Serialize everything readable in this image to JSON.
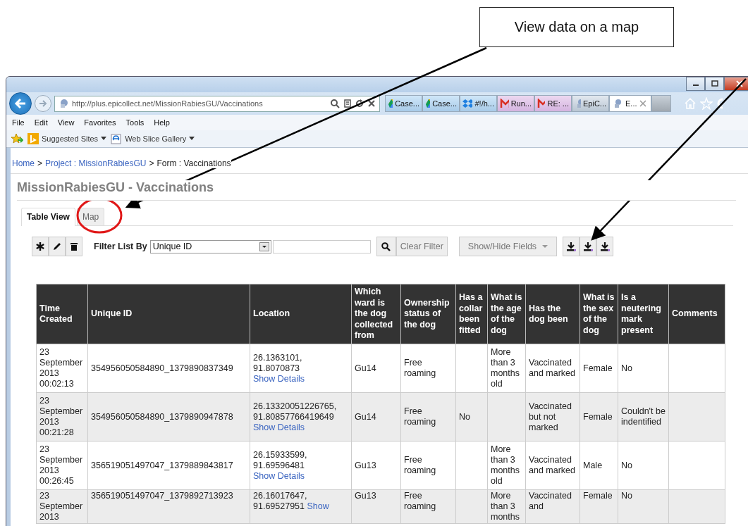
{
  "callout": {
    "text": "View data on a map"
  },
  "browser": {
    "address": "http://plus.epicollect.net/MissionRabiesGU/Vaccinations",
    "tabs": [
      {
        "label": "Case...",
        "kind": "drive",
        "selected": false
      },
      {
        "label": "Case...",
        "kind": "drive",
        "selected": false
      },
      {
        "label": "#!/h...",
        "kind": "box",
        "selected": false
      },
      {
        "label": "Run...",
        "kind": "mail",
        "selected": false
      },
      {
        "label": "RE: ...",
        "kind": "mail",
        "selected": false
      },
      {
        "label": "EpiC...",
        "kind": "page",
        "selected": false
      },
      {
        "label": "E...",
        "kind": "page",
        "selected": true
      }
    ],
    "menu": [
      "File",
      "Edit",
      "View",
      "Favorites",
      "Tools",
      "Help"
    ],
    "favorites": [
      "Suggested Sites",
      "Web Slice Gallery"
    ]
  },
  "page": {
    "breadcrumb": [
      {
        "text": "Home",
        "kind": "link"
      },
      {
        "text": ">",
        "kind": "separator"
      },
      {
        "text": "Project : MissionRabiesGU",
        "kind": "link"
      },
      {
        "text": ">",
        "kind": "separator"
      },
      {
        "text": "Form : Vaccinations",
        "kind": "current"
      }
    ],
    "title": "MissionRabiesGU - Vaccinations",
    "view_tabs": [
      {
        "label": "Table View",
        "selected": true
      },
      {
        "label": "Map",
        "selected": false
      }
    ],
    "filter_label": "Filter List By",
    "filter_select": "Unique ID",
    "clear_filter": "Clear Filter",
    "show_hide": "Show/Hide Fields",
    "table": {
      "columns": [
        "Time Created",
        "Unique ID",
        "Location",
        "Which ward is the dog collected from",
        "Ownership status of the dog",
        "Has a collar been fitted",
        "What is the age of the dog",
        "Has the dog been",
        "What is the sex of the dog",
        "Is a neutering mark present",
        "Comments"
      ],
      "rows": [
        {
          "cells": [
            "23 September 2013 00:02:13",
            "354956050584890_1379890837349",
            {
              "coords": "26.1363101, 91.8070873",
              "link": "Show Details"
            },
            "Gu14",
            "Free roaming",
            null,
            "More than 3 months old",
            "Vaccinated and marked",
            "Female",
            "No",
            null
          ]
        },
        {
          "cells": [
            "23 September 2013 00:21:28",
            "354956050584890_1379890947878",
            {
              "coords": "26.13320051226765, 91.80857766419649",
              "link": "Show Details"
            },
            "Gu14",
            "Free roaming",
            "No",
            null,
            "Vaccinated but not marked",
            "Female",
            "Couldn't be indentified",
            null
          ]
        },
        {
          "cells": [
            "23 September 2013 00:26:45",
            "356519051497047_1379889843817",
            {
              "coords": "26.15933599, 91.69596481",
              "link": "Show Details"
            },
            "Gu13",
            "Free roaming",
            null,
            "More than 3 months old",
            "Vaccinated and marked",
            "Male",
            "No",
            null
          ]
        },
        {
          "cells": [
            "23 September 2013",
            "356519051497047_1379892713923",
            {
              "coords": "26.16017647, 91.69527951",
              "link": "Show"
            },
            "Gu13",
            "Free roaming",
            null,
            "More than 3 months",
            "Vaccinated and",
            "Female",
            "No",
            null
          ]
        }
      ]
    }
  }
}
